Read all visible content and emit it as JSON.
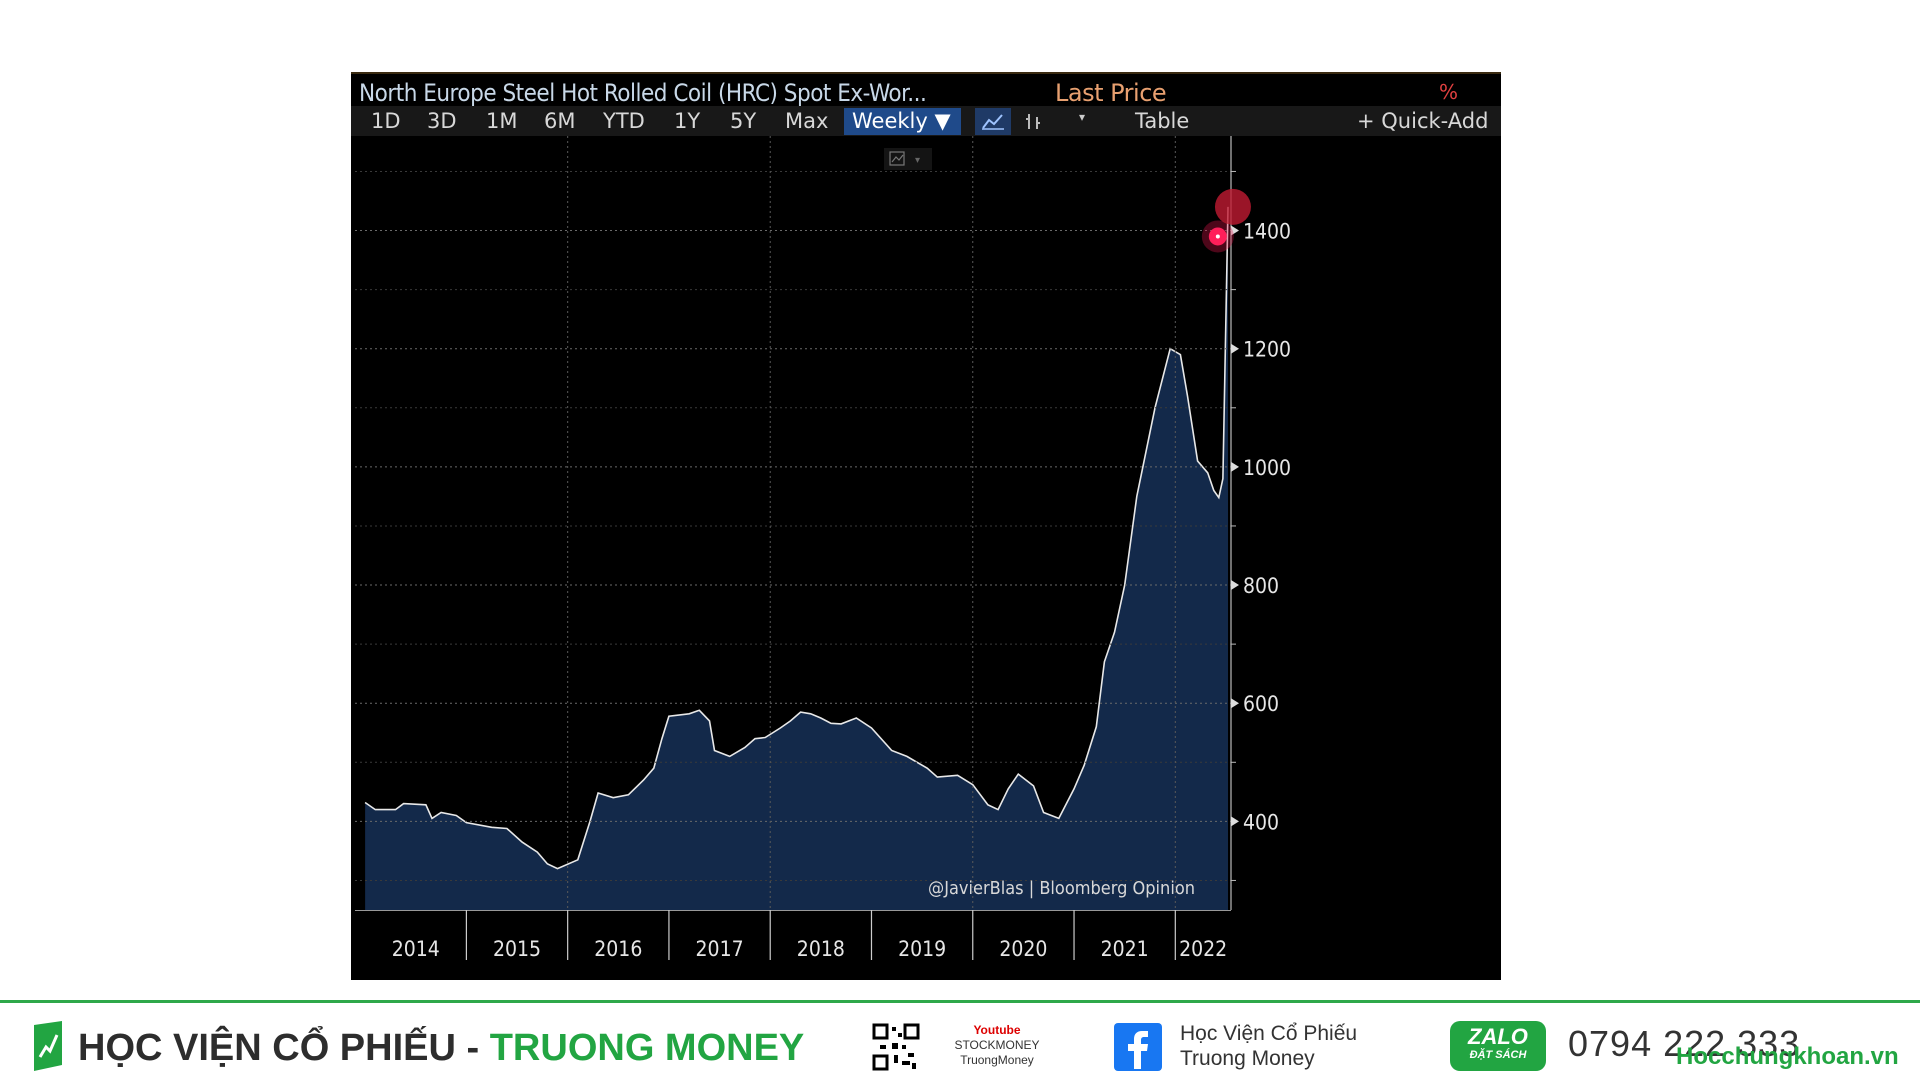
{
  "header": {
    "title": "North Europe Steel Hot Rolled Coil (HRC) Spot Ex-Wor...",
    "field": "Last Price"
  },
  "toolbar": {
    "ranges": [
      "1D",
      "3D",
      "1M",
      "6M",
      "YTD",
      "1Y",
      "5Y",
      "Max"
    ],
    "frequency": "Weekly ▼",
    "table_label": "Table",
    "quick_add": "+ Quick-Add",
    "dropdown_glyph": "▾",
    "pct_glyph": "%",
    "accent": "#1f4a8a"
  },
  "chart_data": {
    "type": "area",
    "title": "North Europe Steel Hot Rolled Coil (HRC) Spot Ex-Wor...",
    "xlabel": "",
    "ylabel": "",
    "ylim": [
      250,
      1560
    ],
    "xlim": [
      2013.9,
      2022.55
    ],
    "y_ticks": [
      400,
      600,
      800,
      1000,
      1200,
      1400
    ],
    "x_ticks": [
      "2014",
      "2015",
      "2016",
      "2017",
      "2018",
      "2019",
      "2020",
      "2021",
      "2022"
    ],
    "grid": true,
    "line_color": "#e8e8e8",
    "fill_color": "#13294a",
    "series": [
      {
        "values": [
          [
            2014.0,
            432
          ],
          [
            2014.1,
            420
          ],
          [
            2014.3,
            420
          ],
          [
            2014.38,
            430
          ],
          [
            2014.6,
            428
          ],
          [
            2014.66,
            405
          ],
          [
            2014.75,
            415
          ],
          [
            2014.9,
            410
          ],
          [
            2015.0,
            398
          ],
          [
            2015.25,
            390
          ],
          [
            2015.4,
            388
          ],
          [
            2015.55,
            365
          ],
          [
            2015.7,
            348
          ],
          [
            2015.8,
            328
          ],
          [
            2015.9,
            320
          ],
          [
            2016.1,
            335
          ],
          [
            2016.22,
            400
          ],
          [
            2016.3,
            448
          ],
          [
            2016.45,
            440
          ],
          [
            2016.6,
            445
          ],
          [
            2016.75,
            470
          ],
          [
            2016.85,
            490
          ],
          [
            2016.93,
            540
          ],
          [
            2017.0,
            578
          ],
          [
            2017.2,
            582
          ],
          [
            2017.3,
            588
          ],
          [
            2017.4,
            570
          ],
          [
            2017.45,
            520
          ],
          [
            2017.6,
            510
          ],
          [
            2017.75,
            525
          ],
          [
            2017.85,
            540
          ],
          [
            2017.95,
            542
          ],
          [
            2018.1,
            558
          ],
          [
            2018.2,
            570
          ],
          [
            2018.3,
            585
          ],
          [
            2018.4,
            582
          ],
          [
            2018.5,
            575
          ],
          [
            2018.6,
            566
          ],
          [
            2018.7,
            565
          ],
          [
            2018.85,
            575
          ],
          [
            2019.0,
            558
          ],
          [
            2019.2,
            520
          ],
          [
            2019.35,
            510
          ],
          [
            2019.55,
            490
          ],
          [
            2019.65,
            475
          ],
          [
            2019.85,
            478
          ],
          [
            2020.0,
            462
          ],
          [
            2020.15,
            428
          ],
          [
            2020.25,
            420
          ],
          [
            2020.35,
            455
          ],
          [
            2020.45,
            480
          ],
          [
            2020.6,
            460
          ],
          [
            2020.7,
            415
          ],
          [
            2020.85,
            405
          ],
          [
            2021.0,
            455
          ],
          [
            2021.1,
            495
          ],
          [
            2021.22,
            560
          ],
          [
            2021.3,
            670
          ],
          [
            2021.4,
            720
          ],
          [
            2021.5,
            800
          ],
          [
            2021.62,
            950
          ],
          [
            2021.8,
            1100
          ],
          [
            2021.95,
            1200
          ],
          [
            2022.05,
            1190
          ],
          [
            2022.12,
            1120
          ],
          [
            2022.22,
            1010
          ],
          [
            2022.32,
            990
          ],
          [
            2022.38,
            960
          ],
          [
            2022.43,
            948
          ],
          [
            2022.47,
            980
          ],
          [
            2022.52,
            1440
          ]
        ]
      }
    ],
    "annotations": [
      "@JavierBlas | Bloomberg Opinion"
    ]
  }
}
